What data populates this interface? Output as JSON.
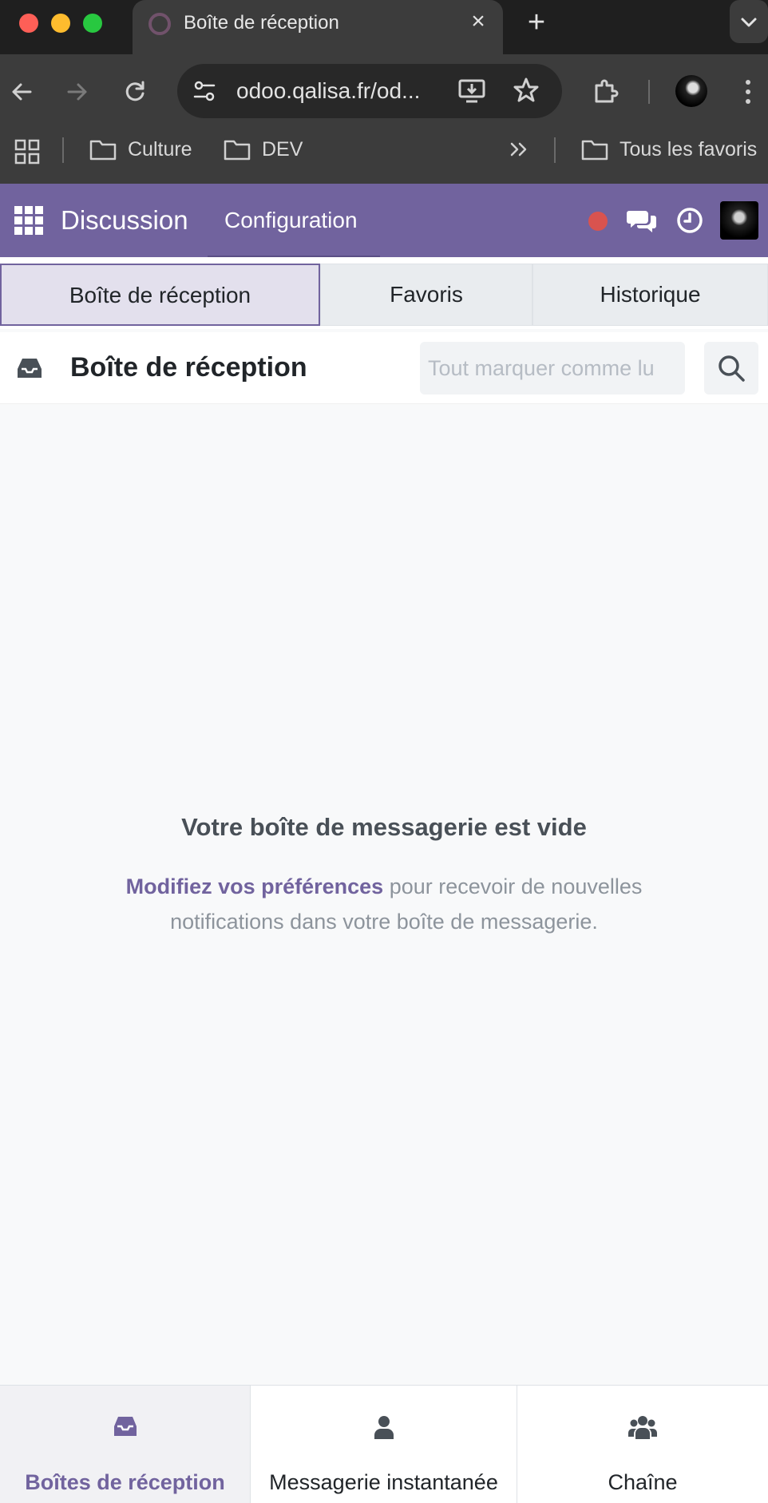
{
  "browser": {
    "tab_title": "Boîte de réception",
    "url": "odoo.qalisa.fr/od...",
    "bookmarks": [
      "Culture",
      "DEV"
    ],
    "all_bookmarks": "Tous les favoris"
  },
  "navbar": {
    "app_name": "Discussion",
    "menu_configuration": "Configuration",
    "status_color": "#d9534f"
  },
  "tabs": [
    {
      "label": "Boîte de réception",
      "active": true
    },
    {
      "label": "Favoris",
      "active": false
    },
    {
      "label": "Historique",
      "active": false
    }
  ],
  "thread": {
    "title": "Boîte de réception",
    "mark_all_read": "Tout marquer comme lu"
  },
  "empty_state": {
    "title": "Votre boîte de messagerie est vide",
    "link": "Modifiez vos préférences",
    "text": " pour recevoir de nouvelles notifications dans votre boîte de messagerie."
  },
  "bottom_nav": [
    {
      "label": "Boîtes de réception",
      "icon": "inbox-icon",
      "active": true
    },
    {
      "label": "Messagerie instantanée",
      "icon": "user-icon",
      "active": false
    },
    {
      "label": "Chaîne",
      "icon": "users-icon",
      "active": false
    }
  ],
  "colors": {
    "brand": "#71639e",
    "navbar": "#71639e"
  }
}
